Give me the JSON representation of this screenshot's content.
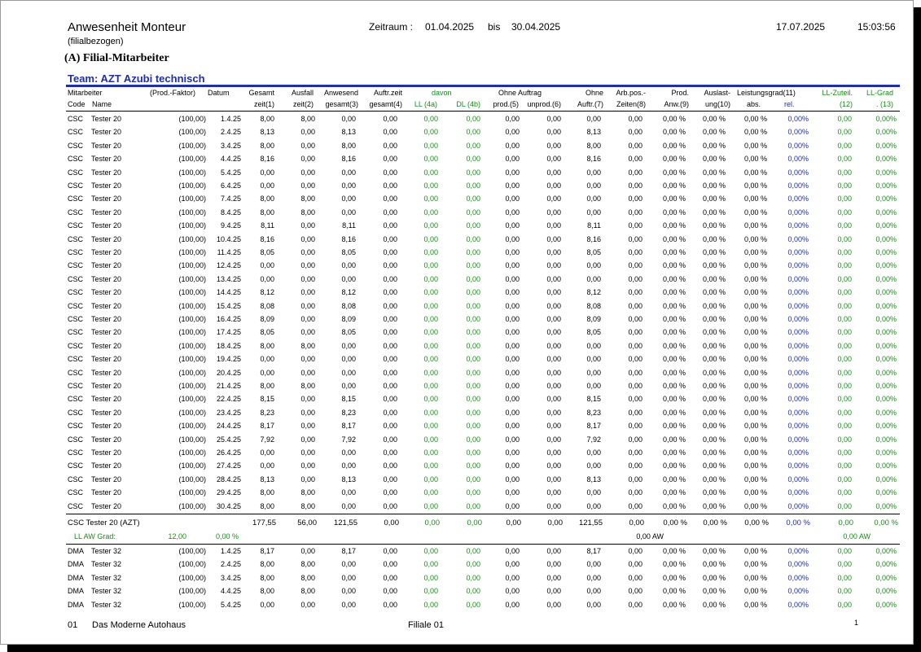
{
  "header": {
    "title": "Anwesenheit Monteur",
    "subtitle": "(filialbezogen)",
    "zeitraum_label": "Zeitraum :",
    "zeitraum_from": "01.04.2025",
    "zeitraum_bis": "bis",
    "zeitraum_to": "30.04.2025",
    "print_date": "17.07.2025",
    "print_time": "15:03:56",
    "section": "(A) Filial-Mitarbeiter",
    "team": "Team: AZT Azubi technisch"
  },
  "columns": {
    "mitarbeiter": "Mitarbeiter",
    "code": "Code",
    "name": "Name",
    "prodfaktor": "(Prod.-Faktor)",
    "datum": "Datum",
    "gesamt1": "Gesamt",
    "gesamt2": "zeit(1)",
    "ausfall1": "Ausfall",
    "ausfall2": "zeit(2)",
    "anwesend1": "Anwesend",
    "anwesend2": "gesamt(3)",
    "auftr1": "Auftr.zeit",
    "auftr2": "gesamt(4)",
    "davon": "davon",
    "ll4a": "LL (4a)",
    "dl4b": "DL (4b)",
    "ohneauftrag": "Ohne Auftrag",
    "prod5": "prod.(5)",
    "unprod6": "unprod.(6)",
    "ohne1": "Ohne",
    "ohne2": "Auftr.(7)",
    "arbpos1": "Arb.pos.-",
    "arbpos2": "Zeiten(8)",
    "prodanw1": "Prod.",
    "prodanw2": "Anw.(9)",
    "auslast1": "Auslast-",
    "auslast2": "ung(10)",
    "leistung": "Leistungsgrad(11)",
    "abs": "abs.",
    "rel": "rel.",
    "llzut1": "LL-Zuteil.",
    "llzut2": "(12)",
    "llgrad1": "LL-Grad",
    "llgrad2": ". (13)"
  },
  "rows": [
    {
      "code": "CSC",
      "name": "Tester 20",
      "pf": "(100,00)",
      "datum": "1.4.25",
      "v": [
        "8,00",
        "8,00",
        "0,00",
        "0,00",
        "0,00",
        "0,00",
        "0,00",
        "0,00",
        "0,00",
        "0,00",
        "0,00 %",
        "0,00 %",
        "0,00 %",
        "0,00%",
        "0,00",
        "0,00%"
      ]
    },
    {
      "code": "CSC",
      "name": "Tester 20",
      "pf": "(100,00)",
      "datum": "2.4.25",
      "v": [
        "8,13",
        "0,00",
        "8,13",
        "0,00",
        "0,00",
        "0,00",
        "0,00",
        "0,00",
        "8,13",
        "0,00",
        "0,00 %",
        "0,00 %",
        "0,00 %",
        "0,00%",
        "0,00",
        "0,00%"
      ]
    },
    {
      "code": "CSC",
      "name": "Tester 20",
      "pf": "(100,00)",
      "datum": "3.4.25",
      "v": [
        "8,00",
        "0,00",
        "8,00",
        "0,00",
        "0,00",
        "0,00",
        "0,00",
        "0,00",
        "8,00",
        "0,00",
        "0,00 %",
        "0,00 %",
        "0,00 %",
        "0,00%",
        "0,00",
        "0,00%"
      ]
    },
    {
      "code": "CSC",
      "name": "Tester 20",
      "pf": "(100,00)",
      "datum": "4.4.25",
      "v": [
        "8,16",
        "0,00",
        "8,16",
        "0,00",
        "0,00",
        "0,00",
        "0,00",
        "0,00",
        "8,16",
        "0,00",
        "0,00 %",
        "0,00 %",
        "0,00 %",
        "0,00%",
        "0,00",
        "0,00%"
      ]
    },
    {
      "code": "CSC",
      "name": "Tester 20",
      "pf": "(100,00)",
      "datum": "5.4.25",
      "v": [
        "0,00",
        "0,00",
        "0,00",
        "0,00",
        "0,00",
        "0,00",
        "0,00",
        "0,00",
        "0,00",
        "0,00",
        "0,00 %",
        "0,00 %",
        "0,00 %",
        "0,00%",
        "0,00",
        "0,00%"
      ]
    },
    {
      "code": "CSC",
      "name": "Tester 20",
      "pf": "(100,00)",
      "datum": "6.4.25",
      "v": [
        "0,00",
        "0,00",
        "0,00",
        "0,00",
        "0,00",
        "0,00",
        "0,00",
        "0,00",
        "0,00",
        "0,00",
        "0,00 %",
        "0,00 %",
        "0,00 %",
        "0,00%",
        "0,00",
        "0,00%"
      ]
    },
    {
      "code": "CSC",
      "name": "Tester 20",
      "pf": "(100,00)",
      "datum": "7.4.25",
      "v": [
        "8,00",
        "8,00",
        "0,00",
        "0,00",
        "0,00",
        "0,00",
        "0,00",
        "0,00",
        "0,00",
        "0,00",
        "0,00 %",
        "0,00 %",
        "0,00 %",
        "0,00%",
        "0,00",
        "0,00%"
      ]
    },
    {
      "code": "CSC",
      "name": "Tester 20",
      "pf": "(100,00)",
      "datum": "8.4.25",
      "v": [
        "8,00",
        "8,00",
        "0,00",
        "0,00",
        "0,00",
        "0,00",
        "0,00",
        "0,00",
        "0,00",
        "0,00",
        "0,00 %",
        "0,00 %",
        "0,00 %",
        "0,00%",
        "0,00",
        "0,00%"
      ]
    },
    {
      "code": "CSC",
      "name": "Tester 20",
      "pf": "(100,00)",
      "datum": "9.4.25",
      "v": [
        "8,11",
        "0,00",
        "8,11",
        "0,00",
        "0,00",
        "0,00",
        "0,00",
        "0,00",
        "8,11",
        "0,00",
        "0,00 %",
        "0,00 %",
        "0,00 %",
        "0,00%",
        "0,00",
        "0,00%"
      ]
    },
    {
      "code": "CSC",
      "name": "Tester 20",
      "pf": "(100,00)",
      "datum": "10.4.25",
      "v": [
        "8,16",
        "0,00",
        "8,16",
        "0,00",
        "0,00",
        "0,00",
        "0,00",
        "0,00",
        "8,16",
        "0,00",
        "0,00 %",
        "0,00 %",
        "0,00 %",
        "0,00%",
        "0,00",
        "0,00%"
      ]
    },
    {
      "code": "CSC",
      "name": "Tester 20",
      "pf": "(100,00)",
      "datum": "11.4.25",
      "v": [
        "8,05",
        "0,00",
        "8,05",
        "0,00",
        "0,00",
        "0,00",
        "0,00",
        "0,00",
        "8,05",
        "0,00",
        "0,00 %",
        "0,00 %",
        "0,00 %",
        "0,00%",
        "0,00",
        "0,00%"
      ]
    },
    {
      "code": "CSC",
      "name": "Tester 20",
      "pf": "(100,00)",
      "datum": "12.4.25",
      "v": [
        "0,00",
        "0,00",
        "0,00",
        "0,00",
        "0,00",
        "0,00",
        "0,00",
        "0,00",
        "0,00",
        "0,00",
        "0,00 %",
        "0,00 %",
        "0,00 %",
        "0,00%",
        "0,00",
        "0,00%"
      ]
    },
    {
      "code": "CSC",
      "name": "Tester 20",
      "pf": "(100,00)",
      "datum": "13.4.25",
      "v": [
        "0,00",
        "0,00",
        "0,00",
        "0,00",
        "0,00",
        "0,00",
        "0,00",
        "0,00",
        "0,00",
        "0,00",
        "0,00 %",
        "0,00 %",
        "0,00 %",
        "0,00%",
        "0,00",
        "0,00%"
      ]
    },
    {
      "code": "CSC",
      "name": "Tester 20",
      "pf": "(100,00)",
      "datum": "14.4.25",
      "v": [
        "8,12",
        "0,00",
        "8,12",
        "0,00",
        "0,00",
        "0,00",
        "0,00",
        "0,00",
        "8,12",
        "0,00",
        "0,00 %",
        "0,00 %",
        "0,00 %",
        "0,00%",
        "0,00",
        "0,00%"
      ]
    },
    {
      "code": "CSC",
      "name": "Tester 20",
      "pf": "(100,00)",
      "datum": "15.4.25",
      "v": [
        "8,08",
        "0,00",
        "8,08",
        "0,00",
        "0,00",
        "0,00",
        "0,00",
        "0,00",
        "8,08",
        "0,00",
        "0,00 %",
        "0,00 %",
        "0,00 %",
        "0,00%",
        "0,00",
        "0,00%"
      ]
    },
    {
      "code": "CSC",
      "name": "Tester 20",
      "pf": "(100,00)",
      "datum": "16.4.25",
      "v": [
        "8,09",
        "0,00",
        "8,09",
        "0,00",
        "0,00",
        "0,00",
        "0,00",
        "0,00",
        "8,09",
        "0,00",
        "0,00 %",
        "0,00 %",
        "0,00 %",
        "0,00%",
        "0,00",
        "0,00%"
      ]
    },
    {
      "code": "CSC",
      "name": "Tester 20",
      "pf": "(100,00)",
      "datum": "17.4.25",
      "v": [
        "8,05",
        "0,00",
        "8,05",
        "0,00",
        "0,00",
        "0,00",
        "0,00",
        "0,00",
        "8,05",
        "0,00",
        "0,00 %",
        "0,00 %",
        "0,00 %",
        "0,00%",
        "0,00",
        "0,00%"
      ]
    },
    {
      "code": "CSC",
      "name": "Tester 20",
      "pf": "(100,00)",
      "datum": "18.4.25",
      "v": [
        "8,00",
        "8,00",
        "0,00",
        "0,00",
        "0,00",
        "0,00",
        "0,00",
        "0,00",
        "0,00",
        "0,00",
        "0,00 %",
        "0,00 %",
        "0,00 %",
        "0,00%",
        "0,00",
        "0,00%"
      ]
    },
    {
      "code": "CSC",
      "name": "Tester 20",
      "pf": "(100,00)",
      "datum": "19.4.25",
      "v": [
        "0,00",
        "0,00",
        "0,00",
        "0,00",
        "0,00",
        "0,00",
        "0,00",
        "0,00",
        "0,00",
        "0,00",
        "0,00 %",
        "0,00 %",
        "0,00 %",
        "0,00%",
        "0,00",
        "0,00%"
      ]
    },
    {
      "code": "CSC",
      "name": "Tester 20",
      "pf": "(100,00)",
      "datum": "20.4.25",
      "v": [
        "0,00",
        "0,00",
        "0,00",
        "0,00",
        "0,00",
        "0,00",
        "0,00",
        "0,00",
        "0,00",
        "0,00",
        "0,00 %",
        "0,00 %",
        "0,00 %",
        "0,00%",
        "0,00",
        "0,00%"
      ]
    },
    {
      "code": "CSC",
      "name": "Tester 20",
      "pf": "(100,00)",
      "datum": "21.4.25",
      "v": [
        "8,00",
        "8,00",
        "0,00",
        "0,00",
        "0,00",
        "0,00",
        "0,00",
        "0,00",
        "0,00",
        "0,00",
        "0,00 %",
        "0,00 %",
        "0,00 %",
        "0,00%",
        "0,00",
        "0,00%"
      ]
    },
    {
      "code": "CSC",
      "name": "Tester 20",
      "pf": "(100,00)",
      "datum": "22.4.25",
      "v": [
        "8,15",
        "0,00",
        "8,15",
        "0,00",
        "0,00",
        "0,00",
        "0,00",
        "0,00",
        "8,15",
        "0,00",
        "0,00 %",
        "0,00 %",
        "0,00 %",
        "0,00%",
        "0,00",
        "0,00%"
      ]
    },
    {
      "code": "CSC",
      "name": "Tester 20",
      "pf": "(100,00)",
      "datum": "23.4.25",
      "v": [
        "8,23",
        "0,00",
        "8,23",
        "0,00",
        "0,00",
        "0,00",
        "0,00",
        "0,00",
        "8,23",
        "0,00",
        "0,00 %",
        "0,00 %",
        "0,00 %",
        "0,00%",
        "0,00",
        "0,00%"
      ]
    },
    {
      "code": "CSC",
      "name": "Tester 20",
      "pf": "(100,00)",
      "datum": "24.4.25",
      "v": [
        "8,17",
        "0,00",
        "8,17",
        "0,00",
        "0,00",
        "0,00",
        "0,00",
        "0,00",
        "8,17",
        "0,00",
        "0,00 %",
        "0,00 %",
        "0,00 %",
        "0,00%",
        "0,00",
        "0,00%"
      ]
    },
    {
      "code": "CSC",
      "name": "Tester 20",
      "pf": "(100,00)",
      "datum": "25.4.25",
      "v": [
        "7,92",
        "0,00",
        "7,92",
        "0,00",
        "0,00",
        "0,00",
        "0,00",
        "0,00",
        "7,92",
        "0,00",
        "0,00 %",
        "0,00 %",
        "0,00 %",
        "0,00%",
        "0,00",
        "0,00%"
      ]
    },
    {
      "code": "CSC",
      "name": "Tester 20",
      "pf": "(100,00)",
      "datum": "26.4.25",
      "v": [
        "0,00",
        "0,00",
        "0,00",
        "0,00",
        "0,00",
        "0,00",
        "0,00",
        "0,00",
        "0,00",
        "0,00",
        "0,00 %",
        "0,00 %",
        "0,00 %",
        "0,00%",
        "0,00",
        "0,00%"
      ]
    },
    {
      "code": "CSC",
      "name": "Tester 20",
      "pf": "(100,00)",
      "datum": "27.4.25",
      "v": [
        "0,00",
        "0,00",
        "0,00",
        "0,00",
        "0,00",
        "0,00",
        "0,00",
        "0,00",
        "0,00",
        "0,00",
        "0,00 %",
        "0,00 %",
        "0,00 %",
        "0,00%",
        "0,00",
        "0,00%"
      ]
    },
    {
      "code": "CSC",
      "name": "Tester 20",
      "pf": "(100,00)",
      "datum": "28.4.25",
      "v": [
        "8,13",
        "0,00",
        "8,13",
        "0,00",
        "0,00",
        "0,00",
        "0,00",
        "0,00",
        "8,13",
        "0,00",
        "0,00 %",
        "0,00 %",
        "0,00 %",
        "0,00%",
        "0,00",
        "0,00%"
      ]
    },
    {
      "code": "CSC",
      "name": "Tester 20",
      "pf": "(100,00)",
      "datum": "29.4.25",
      "v": [
        "8,00",
        "8,00",
        "0,00",
        "0,00",
        "0,00",
        "0,00",
        "0,00",
        "0,00",
        "0,00",
        "0,00",
        "0,00 %",
        "0,00 %",
        "0,00 %",
        "0,00%",
        "0,00",
        "0,00%"
      ]
    },
    {
      "code": "CSC",
      "name": "Tester 20",
      "pf": "(100,00)",
      "datum": "30.4.25",
      "v": [
        "8,00",
        "8,00",
        "0,00",
        "0,00",
        "0,00",
        "0,00",
        "0,00",
        "0,00",
        "0,00",
        "0,00",
        "0,00 %",
        "0,00 %",
        "0,00 %",
        "0,00%",
        "0,00",
        "0,00%"
      ]
    }
  ],
  "total": {
    "label": "CSC Tester 20 (AZT)",
    "v": [
      "177,55",
      "56,00",
      "121,55",
      "0,00",
      "0,00",
      "0,00",
      "0,00",
      "0,00",
      "121,55",
      "0,00",
      "0,00 %",
      "0,00 %",
      "0,00 %",
      "0,00 %",
      "0,00",
      "0,00 %"
    ],
    "ll_label": "LL AW Grad:",
    "ll_val": "12,00",
    "ll_pct": "0,00 %",
    "aw1": "0,00 AW",
    "aw2": "0,00 AW"
  },
  "rows2": [
    {
      "code": "DMA",
      "name": "Tester 32",
      "pf": "(100,00)",
      "datum": "1.4.25",
      "v": [
        "8,17",
        "0,00",
        "8,17",
        "0,00",
        "0,00",
        "0,00",
        "0,00",
        "0,00",
        "8,17",
        "0,00",
        "0,00 %",
        "0,00 %",
        "0,00 %",
        "0,00%",
        "0,00",
        "0,00%"
      ]
    },
    {
      "code": "DMA",
      "name": "Tester 32",
      "pf": "(100,00)",
      "datum": "2.4.25",
      "v": [
        "8,00",
        "8,00",
        "0,00",
        "0,00",
        "0,00",
        "0,00",
        "0,00",
        "0,00",
        "0,00",
        "0,00",
        "0,00 %",
        "0,00 %",
        "0,00 %",
        "0,00%",
        "0,00",
        "0,00%"
      ]
    },
    {
      "code": "DMA",
      "name": "Tester 32",
      "pf": "(100,00)",
      "datum": "3.4.25",
      "v": [
        "8,00",
        "8,00",
        "0,00",
        "0,00",
        "0,00",
        "0,00",
        "0,00",
        "0,00",
        "0,00",
        "0,00",
        "0,00 %",
        "0,00 %",
        "0,00 %",
        "0,00%",
        "0,00",
        "0,00%"
      ]
    },
    {
      "code": "DMA",
      "name": "Tester 32",
      "pf": "(100,00)",
      "datum": "4.4.25",
      "v": [
        "8,00",
        "8,00",
        "0,00",
        "0,00",
        "0,00",
        "0,00",
        "0,00",
        "0,00",
        "0,00",
        "0,00",
        "0,00 %",
        "0,00 %",
        "0,00 %",
        "0,00%",
        "0,00",
        "0,00%"
      ]
    },
    {
      "code": "DMA",
      "name": "Tester 32",
      "pf": "(100,00)",
      "datum": "5.4.25",
      "v": [
        "0,00",
        "0,00",
        "0,00",
        "0,00",
        "0,00",
        "0,00",
        "0,00",
        "0,00",
        "0,00",
        "0,00",
        "0,00 %",
        "0,00 %",
        "0,00 %",
        "0,00%",
        "0,00",
        "0,00%"
      ]
    }
  ],
  "footer": {
    "nr": "01",
    "company": "Das Moderne Autohaus",
    "filiale": "Filiale 01",
    "page": "1"
  },
  "colors": {
    "team_blue": "#1f2fa6",
    "green": "#1a8a1a"
  }
}
